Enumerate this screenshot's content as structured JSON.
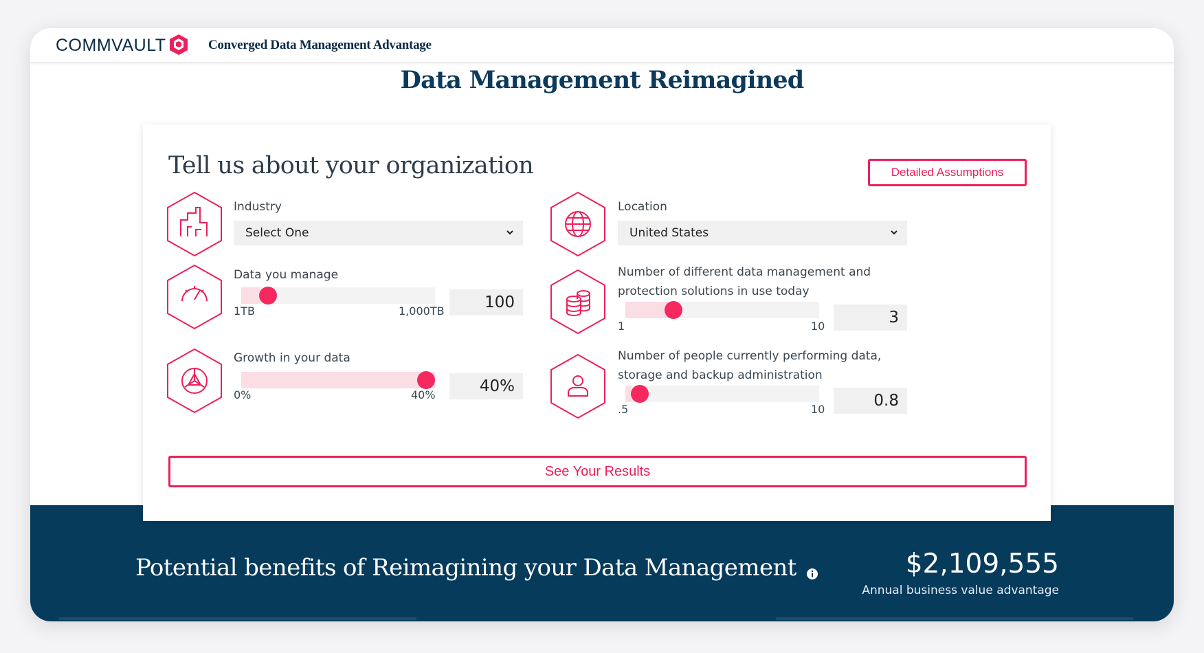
{
  "header": {
    "brand": "COMMVAULT",
    "product": "Converged Data Management Advantage",
    "colors": {
      "navy": "#0c2a48",
      "accent": "#ee1f5a"
    }
  },
  "page": {
    "title": "Data Management Reimagined"
  },
  "form": {
    "title": "Tell us about your organization",
    "assumptions_label": "Detailed Assumptions",
    "industry": {
      "label": "Industry",
      "value": "Select One",
      "icon": "buildings-icon"
    },
    "location": {
      "label": "Location",
      "value": "United States",
      "icon": "globe-icon"
    },
    "data_managed": {
      "label": "Data you manage",
      "min": "1TB",
      "max": "1,000TB",
      "value": "100",
      "fraction": 0.1,
      "icon": "gauge-icon"
    },
    "solutions": {
      "label": "Number of different data management and protection solutions in use today",
      "min": "1",
      "max": "10",
      "value": "3",
      "fraction": 0.222,
      "icon": "database-icon"
    },
    "growth": {
      "label": "Growth in your data",
      "min": "0%",
      "max": "40%",
      "value": "40%",
      "fraction": 1.0,
      "icon": "growth-cube-icon"
    },
    "people": {
      "label": "Number of people currently performing data, storage and backup administration",
      "min": ".5",
      "max": "10",
      "value": "0.8",
      "fraction": 0.032,
      "icon": "person-icon"
    },
    "submit_label": "See Your Results"
  },
  "benefits": {
    "title": "Potential benefits of Reimagining your Data Management",
    "value": "$2,109,555",
    "caption": "Annual business value advantage",
    "band_color": "#063b5c"
  }
}
